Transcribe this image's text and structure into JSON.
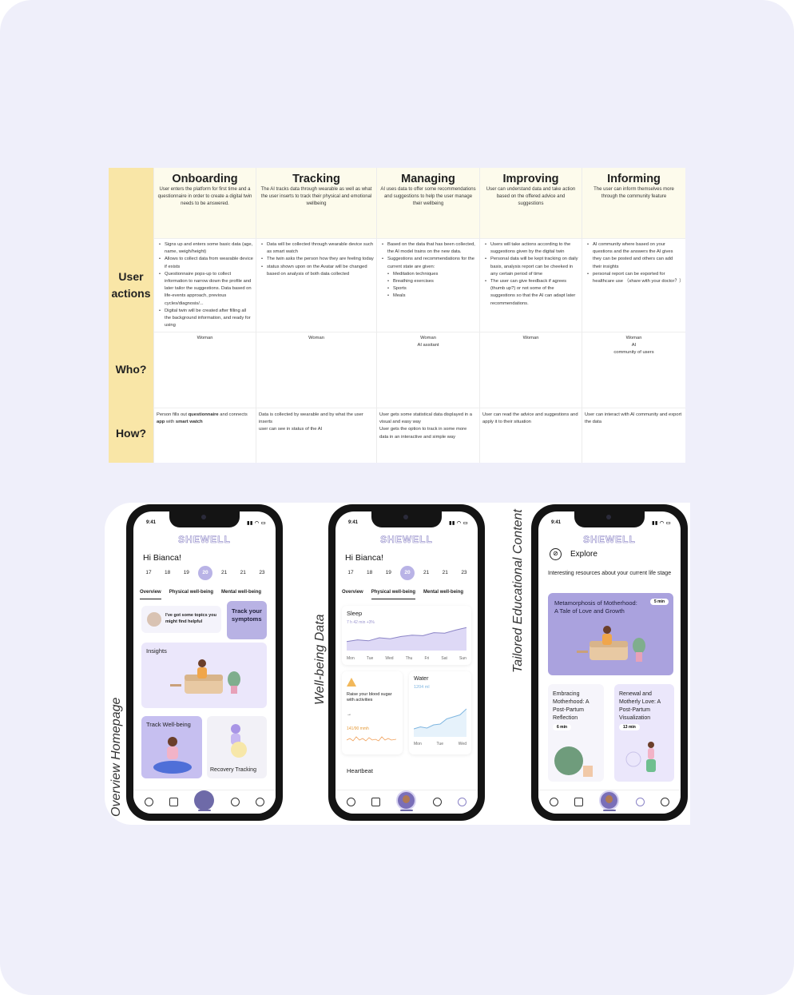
{
  "journey": {
    "row_labels": [
      "User actions",
      "Who?",
      "How?"
    ],
    "stages": [
      {
        "title": "Onboarding",
        "desc": "User enters the platform for first time and a questionnaire in order to create a digital twin needs to be answered.",
        "actions": [
          "Signs up and enters some basic data (age, name, weigh/height)",
          "Allows to collect data from wearable device if exists",
          "Questionnaire pops-up to collect information to narrow down the profile and later tailor the suggestions. Data based on life-events approach, previous cycles/diagnosis/...",
          "Digital twin will be created after filling all the background information, and ready for using"
        ],
        "who": "Woman",
        "how_pre": "Person fills out ",
        "how_b1": "questionnaire",
        "how_mid": " and connects ",
        "how_b2": "app",
        "how_mid2": " with ",
        "how_b3": "smart watch"
      },
      {
        "title": "Tracking",
        "desc": "The AI tracks data through wearable as well as what the user inserts to track their physical and emotional wellbeing",
        "actions": [
          "Data will be collected through wearable device such as smart watch",
          "The twin asks the person how they are feeling today",
          "status shown upon on the Avatar will be changed based on analysis of both data collected"
        ],
        "who": "Woman",
        "how": "Data is collected by wearable and by what the user inserts\nuser can see in status of the AI"
      },
      {
        "title": "Managing",
        "desc": "AI uses data to offer some recommendations and suggestions to help the user manage their wellbeing",
        "actions": [
          "Based on the data that has been collected, the AI model trains on the new data.",
          "Suggestions and recommendations for the current state are given:"
        ],
        "sub_actions": [
          "Meditation techniques",
          "Breathing exercises",
          "Sports",
          "Meals"
        ],
        "who": "Woman\nAI assitant",
        "how": "User gets some statistical data displayed in a visual and easy way\nUser gets the option to track in some more data in an interactive and simple way"
      },
      {
        "title": "Improving",
        "desc": "User can understand data and take action based on the offered advice and suggestions",
        "actions": [
          "Users will take actions according to the suggestions given by the digital twin",
          "Personal data will be kept tracking on daily basis, analysis report can be cheeked in any certain period of time",
          "The user can give feedback if agrees (thumb up?) or not some of the suggestions so that the AI can adapt later recommendations."
        ],
        "who": "Woman",
        "how": "User can read the advice and suggestions and apply it to their situation"
      },
      {
        "title": "Informing",
        "desc": "The user can inform themselves more through the community feature",
        "actions": [
          "AI community where based on your questions and the answers the AI gives they can be posted and others can add their insights",
          "personal report can be exported for healthcare use （share with your doctor？）"
        ],
        "who": "Woman\nAI\ncommunity of users",
        "how": "User can interact with AI community and export the data"
      }
    ]
  },
  "sections": {
    "overview": "Overview Homepage",
    "wellbeing": "Well-being Data",
    "education": "Tailored Educational Content"
  },
  "app": {
    "time": "9:41",
    "brand": "SHEWELL",
    "greeting": "Hi Bianca!",
    "dates": [
      "17",
      "18",
      "19",
      "20",
      "21",
      "21",
      "23"
    ],
    "selected_date": "20",
    "tabs": [
      "Overview",
      "Physical well-being",
      "Mental well-being"
    ]
  },
  "home": {
    "topics": "I've got some topics you might find helpful",
    "track_symptoms": "Track your symptoms",
    "insights": "Insights",
    "track_wellbeing": "Track Well-being",
    "recovery": "Recovery Tracking"
  },
  "wellbeing": {
    "sleep_title": "Sleep",
    "sleep_sub": "7 h 42 min  +3%",
    "days": [
      "Mon",
      "Tue",
      "Wed",
      "Thu",
      "Fri",
      "Sat",
      "Sun"
    ],
    "alert": "Raise your blood sugar with activities",
    "alert_arrow": "→",
    "alert_value": "141/90 mmh",
    "water_title": "Water",
    "water_value": "1204 ml",
    "water_days": [
      "Mon",
      "Tue",
      "Wed"
    ],
    "heartbeat": "Heartbeat",
    "sleep_series": [
      0.35,
      0.42,
      0.38,
      0.5,
      0.46,
      0.55,
      0.6,
      0.58,
      0.7,
      0.68,
      0.8,
      0.9
    ],
    "water_series": [
      0.2,
      0.25,
      0.22,
      0.3,
      0.32,
      0.45,
      0.5,
      0.55,
      0.7
    ]
  },
  "explore": {
    "title": "Explore",
    "intro": "Interesting resources about your current life stage",
    "featured_title": "Metamorphosis of Motherhood: A Tale of Love and Growth",
    "featured_time": "5 min",
    "card1_title": "Embracing Motherhood: A Post-Partum Reflection",
    "card1_time": "6 min",
    "card2_title": "Renewal and Motherly Love: A Post-Partum Visualization",
    "card2_time": "13 min"
  },
  "colors": {
    "accent": "#b9b3e6",
    "lavender": "#ebe7fb",
    "deep_lavender": "#aaa2de",
    "nav": "#6e6aa8",
    "journey_label": "#f9e6a7",
    "journey_head": "#fdfbec"
  }
}
